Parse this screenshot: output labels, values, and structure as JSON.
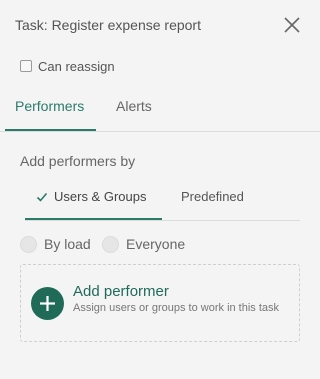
{
  "header": {
    "title": "Task: Register expense report",
    "close_icon": "close-icon"
  },
  "options": {
    "can_reassign_label": "Can reassign",
    "can_reassign_checked": false
  },
  "tabs": [
    {
      "label": "Performers",
      "active": true
    },
    {
      "label": "Alerts",
      "active": false
    }
  ],
  "performers": {
    "section_label": "Add performers by",
    "subtabs": [
      {
        "label": "Users & Groups",
        "active": true,
        "icon": "check-icon"
      },
      {
        "label": "Predefined",
        "active": false
      }
    ],
    "assignment": [
      {
        "label": "By load",
        "selected": false
      },
      {
        "label": "Everyone",
        "selected": false
      }
    ],
    "add": {
      "title": "Add performer",
      "description": "Assign users or groups to work in this task",
      "icon": "plus-icon"
    }
  },
  "colors": {
    "accent": "#2a7b68",
    "accent_dark": "#1f6b58",
    "background": "#f4f4f4"
  }
}
